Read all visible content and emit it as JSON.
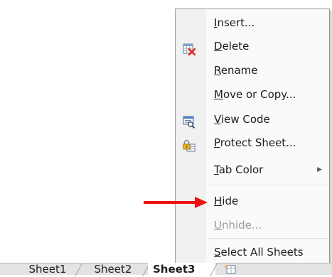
{
  "context_menu": {
    "items": [
      {
        "label": "Insert...",
        "icon": "",
        "enabled": true
      },
      {
        "label": "Delete",
        "icon": "delete-sheet-icon",
        "enabled": true
      },
      {
        "label": "Rename",
        "icon": "",
        "enabled": true
      },
      {
        "label": "Move or Copy...",
        "icon": "",
        "enabled": true
      },
      {
        "label": "View Code",
        "icon": "view-code-icon",
        "enabled": true
      },
      {
        "label": "Protect Sheet...",
        "icon": "protect-sheet-icon",
        "enabled": true
      },
      {
        "label": "Tab Color",
        "icon": "",
        "enabled": true,
        "submenu": true
      },
      {
        "label": "Hide",
        "icon": "",
        "enabled": true
      },
      {
        "label": "Unhide...",
        "icon": "",
        "enabled": false
      },
      {
        "label": "Select All Sheets",
        "icon": "",
        "enabled": true
      }
    ],
    "submenu_arrow": "▶"
  },
  "sheet_tabs": {
    "tabs": [
      "Sheet1",
      "Sheet2",
      "Sheet3"
    ],
    "active_index": 2,
    "new_sheet_icon": "insert-worksheet-icon"
  },
  "annotation": {
    "arrow_color": "#ee1111",
    "points_to": "Hide"
  }
}
